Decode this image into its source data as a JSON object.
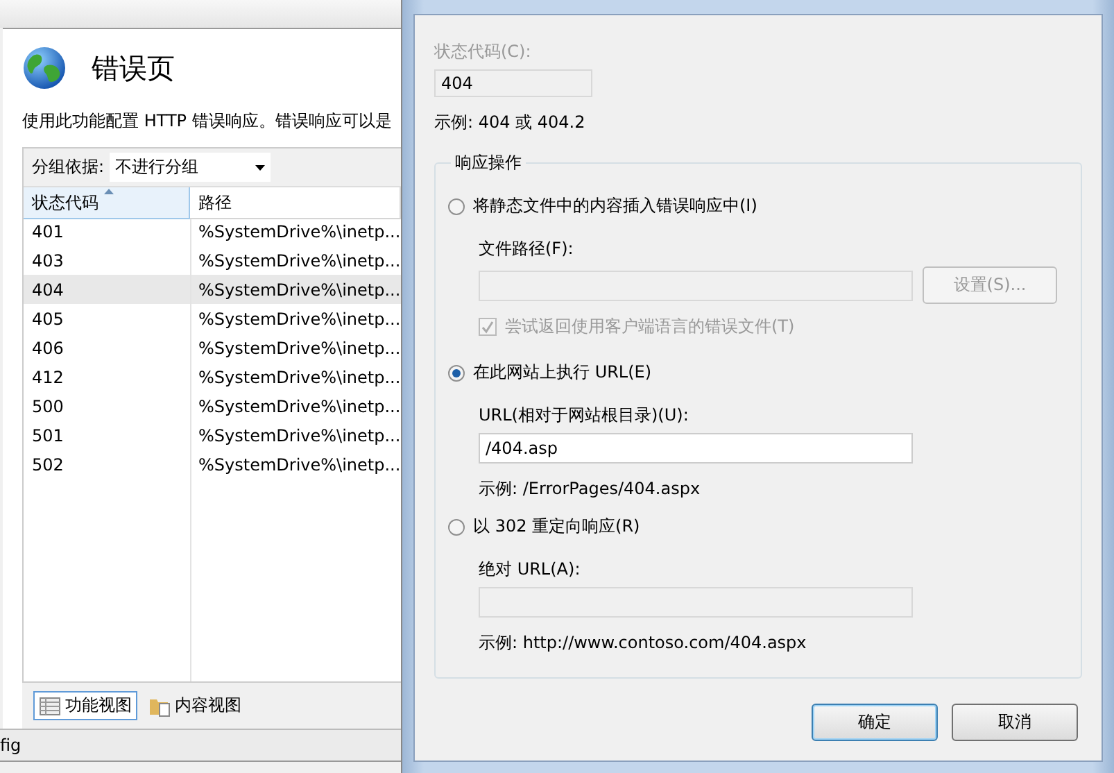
{
  "main": {
    "title": "错误页",
    "description": "使用此功能配置 HTTP 错误响应。错误响应可以是",
    "group_by": {
      "label": "分组依据:",
      "value": "不进行分组"
    },
    "table": {
      "columns": [
        {
          "label": "状态代码",
          "sorted": true
        },
        {
          "label": "路径",
          "sorted": false
        }
      ],
      "rows": [
        {
          "cells": [
            "401",
            "%SystemDrive%\\inetp..."
          ],
          "selected": false
        },
        {
          "cells": [
            "403",
            "%SystemDrive%\\inetp..."
          ],
          "selected": false
        },
        {
          "cells": [
            "404",
            "%SystemDrive%\\inetp..."
          ],
          "selected": true
        },
        {
          "cells": [
            "405",
            "%SystemDrive%\\inetp..."
          ],
          "selected": false
        },
        {
          "cells": [
            "406",
            "%SystemDrive%\\inetp..."
          ],
          "selected": false
        },
        {
          "cells": [
            "412",
            "%SystemDrive%\\inetp..."
          ],
          "selected": false
        },
        {
          "cells": [
            "500",
            "%SystemDrive%\\inetp..."
          ],
          "selected": false
        },
        {
          "cells": [
            "501",
            "%SystemDrive%\\inetp..."
          ],
          "selected": false
        },
        {
          "cells": [
            "502",
            "%SystemDrive%\\inetp..."
          ],
          "selected": false
        }
      ]
    },
    "view_tabs": [
      {
        "label": "功能视图",
        "selected": true
      },
      {
        "label": "内容视图",
        "selected": false
      }
    ],
    "status_bar": "fig"
  },
  "dialog": {
    "status_code": {
      "label": "状态代码(C):",
      "value": "404",
      "disabled": true
    },
    "example": "示例: 404 或 404.2",
    "response": {
      "legend": "响应操作",
      "options": [
        {
          "label": "将静态文件中的内容插入错误响应中(I)",
          "selected": false,
          "field_label": "文件路径(F):",
          "button": "设置(S)...",
          "checkbox": {
            "label": "尝试返回使用客户端语言的错误文件(T)",
            "checked": true
          }
        },
        {
          "label": "在此网站上执行 URL(E)",
          "selected": true,
          "field_label": "URL(相对于网站根目录)(U):",
          "field_value": "/404.asp",
          "example": "示例: /ErrorPages/404.aspx"
        },
        {
          "label": "以 302 重定向响应(R)",
          "selected": false,
          "field_label": "绝对 URL(A):",
          "example": "示例: http://www.contoso.com/404.aspx"
        }
      ]
    },
    "buttons": [
      {
        "label": "确定",
        "default": true
      },
      {
        "label": "取消",
        "default": false
      }
    ]
  }
}
